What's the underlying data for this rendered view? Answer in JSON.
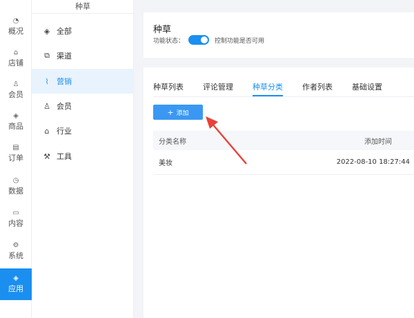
{
  "nav": {
    "items": [
      {
        "icon": "gauge-icon",
        "glyph": "◔",
        "label": "概况"
      },
      {
        "icon": "store-icon",
        "glyph": "⌂",
        "label": "店铺"
      },
      {
        "icon": "user-icon",
        "glyph": "♙",
        "label": "会员"
      },
      {
        "icon": "box-icon",
        "glyph": "◈",
        "label": "商品"
      },
      {
        "icon": "clipboard-icon",
        "glyph": "▤",
        "label": "订单"
      },
      {
        "icon": "pie-chart-icon",
        "glyph": "◷",
        "label": "数据"
      },
      {
        "icon": "folder-icon",
        "glyph": "▭",
        "label": "内容"
      },
      {
        "icon": "gear-icon",
        "glyph": "⚙",
        "label": "系统"
      },
      {
        "icon": "cube-icon",
        "glyph": "◈",
        "label": "应用",
        "active": true
      }
    ]
  },
  "sub": {
    "title": "种草",
    "items": [
      {
        "icon": "cube-icon",
        "glyph": "◈",
        "label": "全部"
      },
      {
        "icon": "channel-icon",
        "glyph": "⧉",
        "label": "渠道"
      },
      {
        "icon": "chart-line-icon",
        "glyph": "⌇",
        "label": "营销",
        "active": true
      },
      {
        "icon": "user-icon",
        "glyph": "♙",
        "label": "会员"
      },
      {
        "icon": "store-icon",
        "glyph": "⌂",
        "label": "行业"
      },
      {
        "icon": "wrench-icon",
        "glyph": "⚒",
        "label": "工具"
      }
    ]
  },
  "header": {
    "title": "种草",
    "status_label": "功能状态：",
    "status_desc": "控制功能是否可用",
    "toggle_on": true
  },
  "tabs": [
    {
      "label": "种草列表"
    },
    {
      "label": "评论管理"
    },
    {
      "label": "种草分类",
      "active": true
    },
    {
      "label": "作者列表"
    },
    {
      "label": "基础设置"
    }
  ],
  "add_button": {
    "label": "添加",
    "plus": "+"
  },
  "table": {
    "columns": [
      "分类名称",
      "添加时间"
    ],
    "rows": [
      {
        "name": "美妆",
        "time": "2022-08-10 18:27:44"
      }
    ]
  },
  "colors": {
    "accent": "#1a8ff0",
    "arrow": "#e8423a"
  }
}
